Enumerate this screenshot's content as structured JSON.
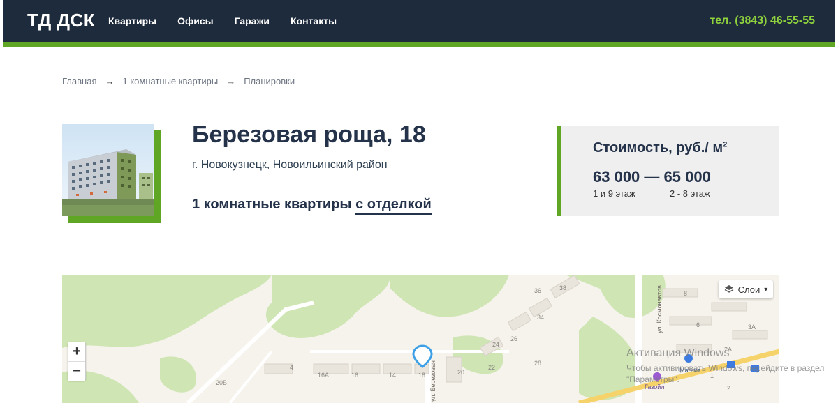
{
  "header": {
    "logo": "ТД ДСК",
    "nav": [
      "Квартиры",
      "Офисы",
      "Гаражи",
      "Контакты"
    ],
    "phone": "тел. (3843) 46-55-55"
  },
  "breadcrumb": [
    "Главная",
    "1 комнатные квартиры",
    "Планировки"
  ],
  "breadcrumb_separator": "→",
  "building": {
    "title": "Березовая роща, 18",
    "address": "г. Новокузнецк, Новоильинский район",
    "apartments_prefix": "1 комнатные квартиры",
    "apartments_link": "с отделкой"
  },
  "price": {
    "title": "Стоимость, руб./ м",
    "title_sup": "2",
    "range": "63 000 — 65 000",
    "floors_1": "1 и 9 этаж",
    "floors_2": "2 - 8 этаж"
  },
  "map": {
    "zoom_in": "+",
    "zoom_out": "−",
    "layers_label": "Слои",
    "street_labels": [
      "ул. Космонавтов",
      "ул. Березовая"
    ],
    "house_numbers": [
      "36",
      "38",
      "8",
      "6",
      "34",
      "3А",
      "26",
      "24",
      "4",
      "20Б",
      "16А",
      "16",
      "14",
      "18",
      "20",
      "22",
      "28",
      "2А",
      "1",
      "2"
    ],
    "poi": [
      "Магнит",
      "Газойл"
    ]
  },
  "watermark": {
    "line1": "Активация Windows",
    "line2": "Чтобы активировать Windows, перейдите в раздел \"Параметры\"."
  },
  "colors": {
    "header_bg": "#1e2b3c",
    "accent_green": "#5fa624",
    "phone_green": "#8ed13c"
  }
}
